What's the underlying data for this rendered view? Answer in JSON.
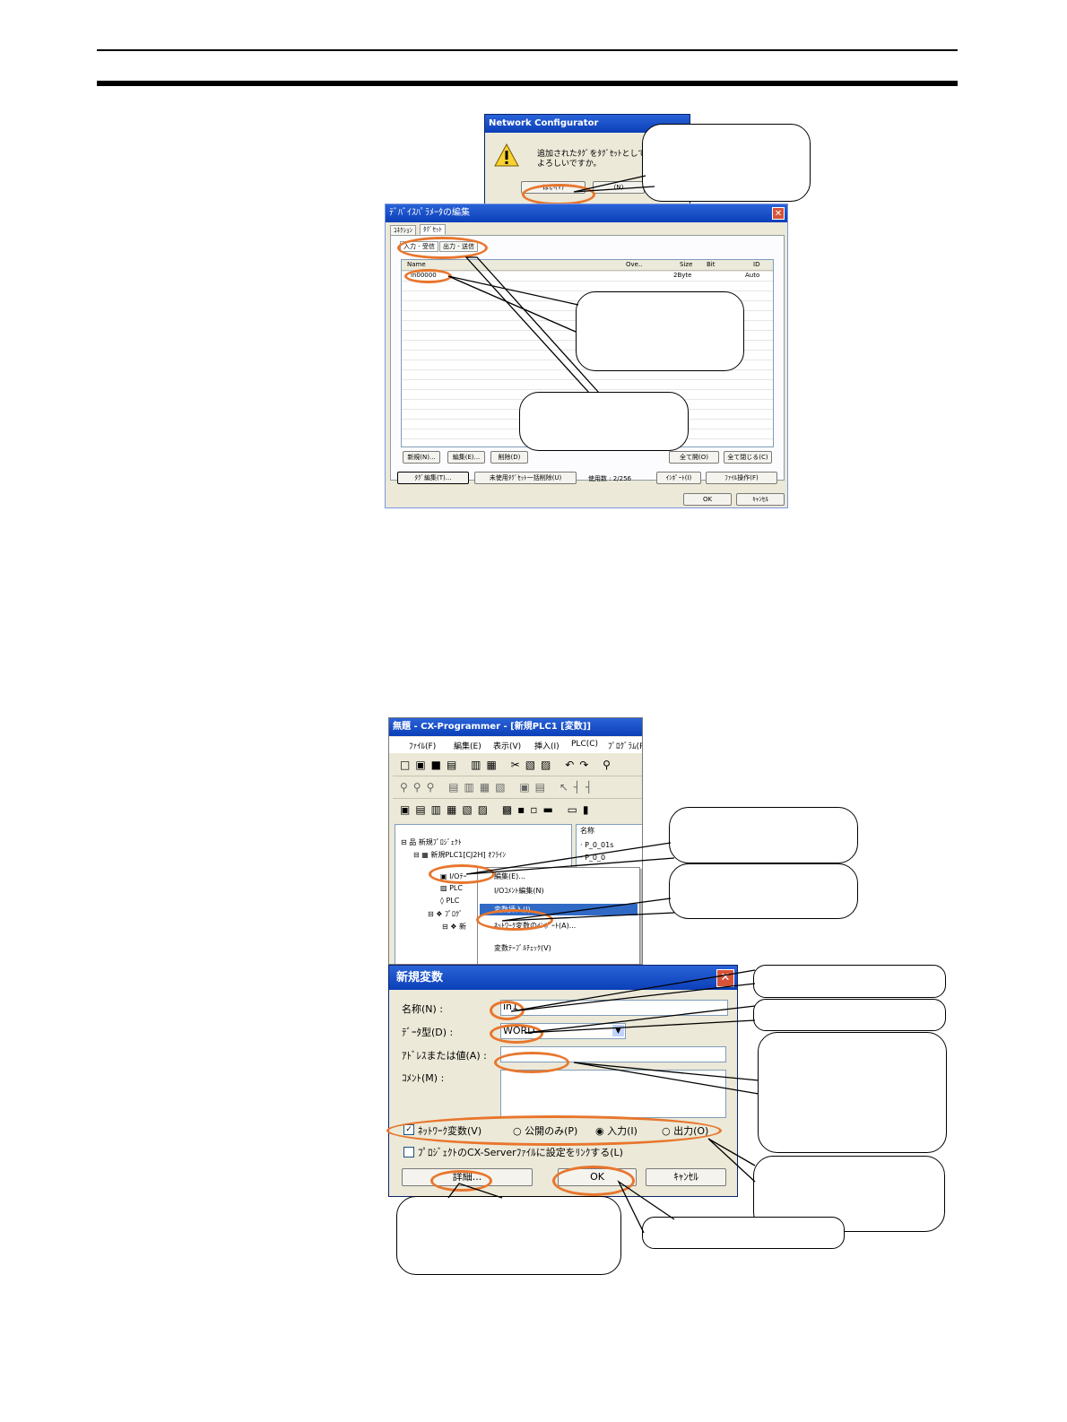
{
  "fig1": {
    "msg_title": "Network Configurator",
    "msg_text_1": "追加されたﾀｸﾞをﾀｸﾞｾｯﾄとして登",
    "msg_text_2": "よろしいですか。",
    "msg_yes": "はい(Y)",
    "msg_no": "(N)",
    "editor_title": "ﾃﾞﾊﾞｲｽﾊﾟﾗﾒｰﾀの編集",
    "tab_connection": "ｺﾈｸｼｮﾝ",
    "tab_tagset": "ﾀｸﾞｾｯﾄ",
    "subtab_in": "入力 - 受信",
    "subtab_out": "出力 - 送信",
    "col_name": "Name",
    "col_ove": "Ove..",
    "col_size": "Size",
    "col_bit": "Bit",
    "col_id": "ID",
    "row_name": "in00000",
    "row_size": "2Byte",
    "row_id": "Auto",
    "btn_new": "新規(N)...",
    "btn_edit": "編集(E)...",
    "btn_delete": "削除(D)",
    "btn_expand": "全て開(O)",
    "btn_collapse": "全て閉じる(C)",
    "btn_tag_edit": "ﾀｸﾞ編集(T)...",
    "btn_unused_delete": "未使用ﾀｸﾞｾｯﾄ一括削除(U)",
    "usage_label": "使用数 : 2/256",
    "btn_import": "ｲﾝﾎﾟｰﾄ(I)",
    "btn_file_ops": "ﾌｧｲﾙ操作(F)",
    "btn_ok": "OK",
    "btn_cancel": "ｷｬﾝｾﾙ"
  },
  "fig2": {
    "app_title": "無題 - CX-Programmer - [新規PLC1 [変数]]",
    "menu": [
      "ﾌｧｲﾙ(F)",
      "編集(E)",
      "表示(V)",
      "挿入(I)",
      "PLC(C)",
      "ﾌﾟﾛｸﾞﾗﾑ(P)"
    ],
    "tree_project": "新規ﾌﾟﾛｼﾞｪｸﾄ",
    "tree_plc": "新規PLC1[CJ2H] ｵﾌﾗｲﾝ",
    "tree_io": "I/Oﾃｰ",
    "tree_plc2": "PLC",
    "tree_plc3": "PLC",
    "tree_prog": "ﾌﾟﾛｸﾞ",
    "tree_new": "新",
    "list_header": "名称",
    "list_item1": "P_0_01s",
    "list_item2": "P_0_0",
    "ctx_edit": "編集(E)...",
    "ctx_io_comment": "I/Oｺﾒﾝﾄ編集(N)",
    "ctx_insert": "変数挿入(I)",
    "ctx_import": "ﾈｯﾄﾜｰｸ変数のｲﾝﾎﾟｰﾄ(A)...",
    "ctx_check": "変数ﾃｰﾌﾞﾙﾁｪｯｸ(V)",
    "dlg_title": "新規変数",
    "lbl_name": "名称(N) :",
    "lbl_type": "ﾃﾞｰﾀ型(D) :",
    "lbl_addr": "ｱﾄﾞﾚｽまたは値(A) :",
    "lbl_comment": "ｺﾒﾝﾄ(M) :",
    "val_name": "in1",
    "val_type": "WORD",
    "lbl_netvar": "ﾈｯﾄﾜｰｸ変数(V)",
    "opt_public": "公開のみ(P)",
    "opt_input": "入力(I)",
    "opt_output": "出力(O)",
    "lbl_link": "ﾌﾟﾛｼﾞｪｸﾄのCX-Serverﾌｧｲﾙに設定をﾘﾝｸする(L)",
    "btn_detail": "詳細...",
    "btn_ok": "OK",
    "btn_cancel": "ｷｬﾝｾﾙ"
  },
  "colors": {
    "accent": "#e8762d",
    "titlebar": "#0b3fb8",
    "window_bg": "#ece9d8"
  }
}
